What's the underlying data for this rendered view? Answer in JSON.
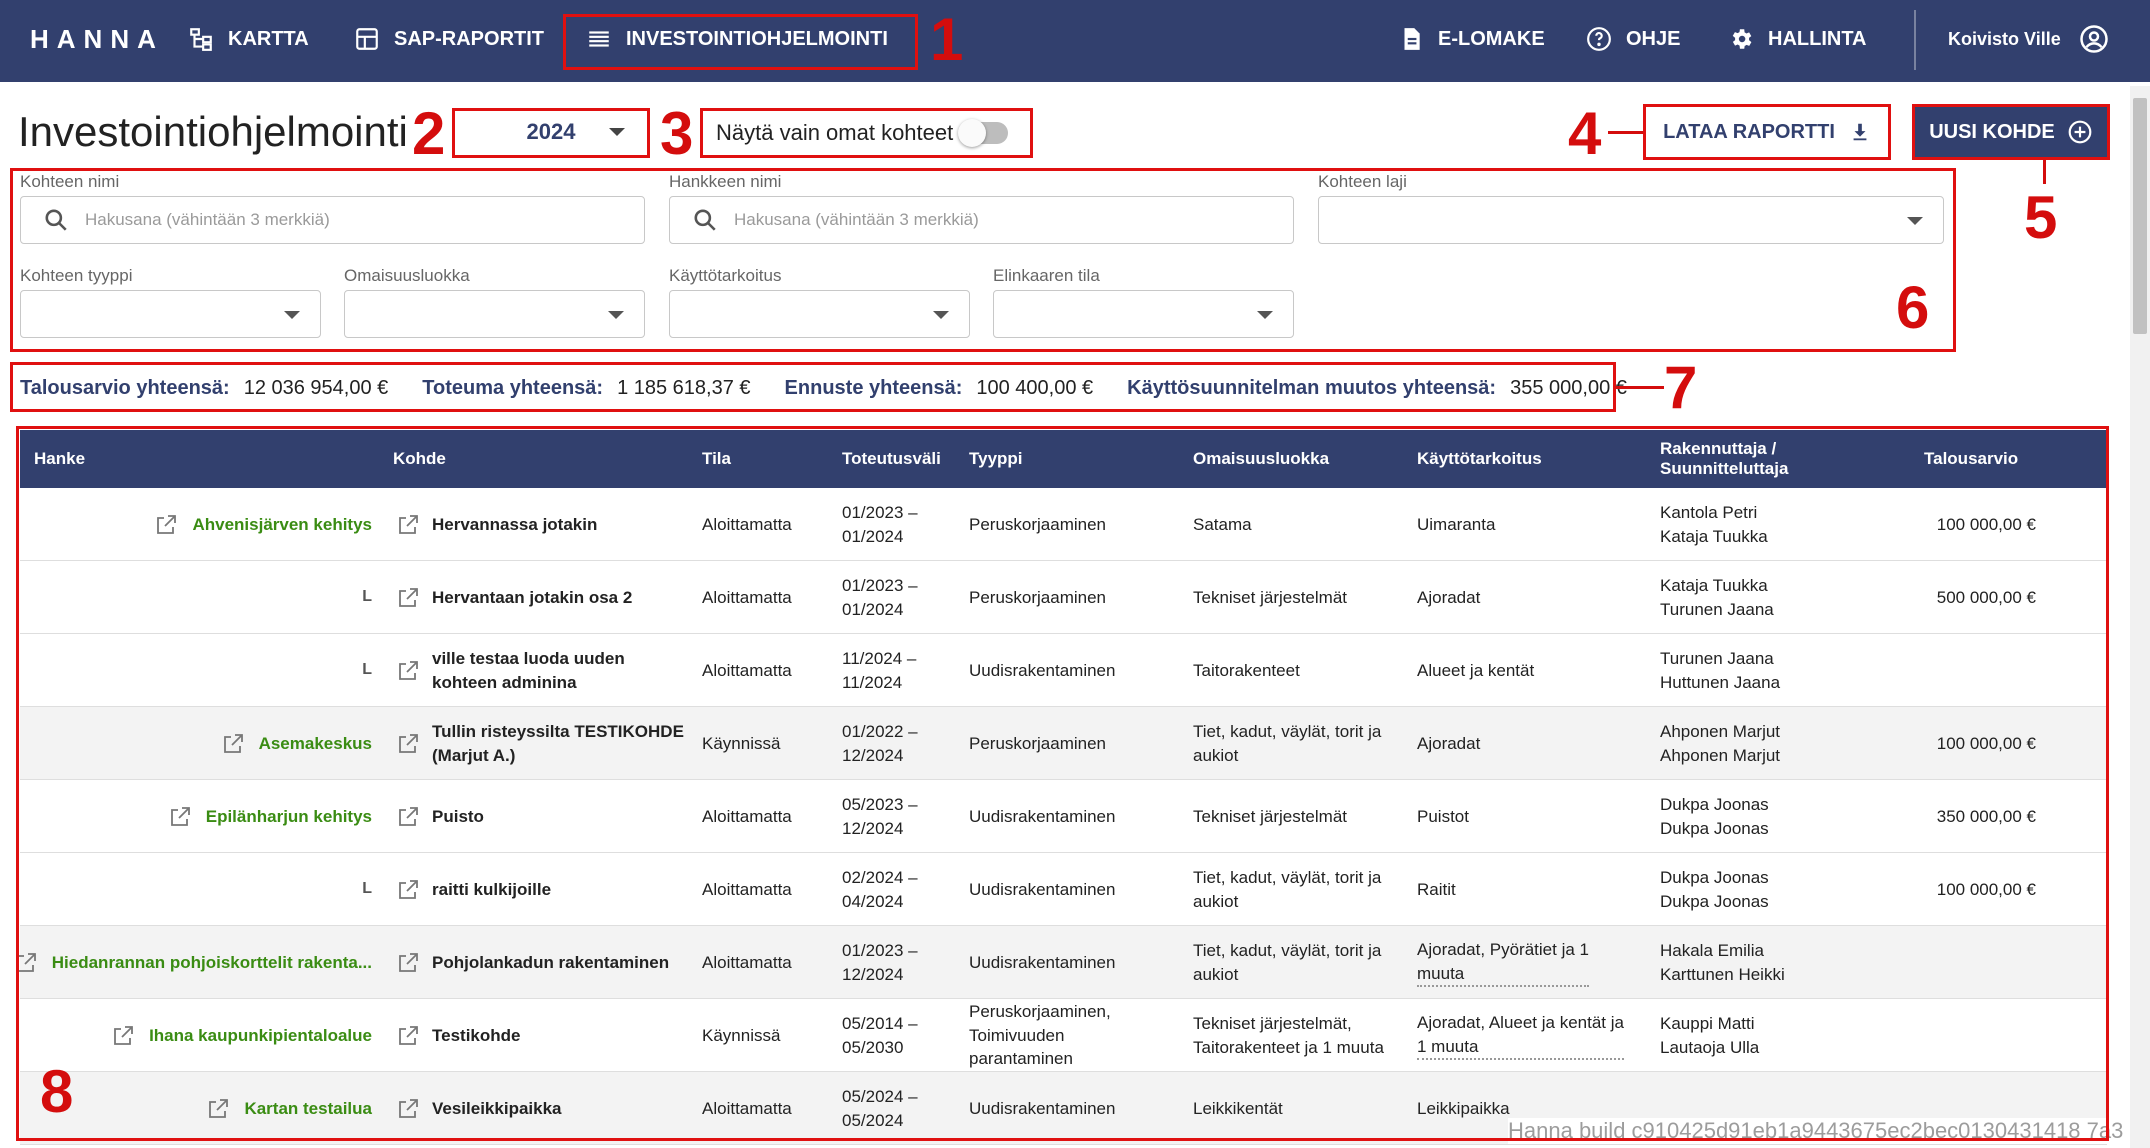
{
  "nav": {
    "logo": "HANNA",
    "items": [
      {
        "label": "KARTTA",
        "icon": "hierarchy-icon"
      },
      {
        "label": "SAP-RAPORTIT",
        "icon": "report-icon"
      },
      {
        "label": "INVESTOINTIOHJELMOINTI",
        "icon": "list-icon"
      }
    ],
    "right_items": [
      {
        "label": "E-LOMAKE",
        "icon": "document-icon"
      },
      {
        "label": "OHJE",
        "icon": "help-icon"
      },
      {
        "label": "HALLINTA",
        "icon": "gear-icon"
      }
    ],
    "user": "Koivisto Ville"
  },
  "page": {
    "title": "Investointiohjelmointi",
    "year": "2024",
    "toggle_label": "Näytä vain omat kohteet",
    "report_button": "LATAA RAPORTTI",
    "new_button": "UUSI KOHDE"
  },
  "filters": {
    "kohteen_nimi": {
      "label": "Kohteen nimi",
      "placeholder": "Hakusana (vähintään 3 merkkiä)"
    },
    "hankkeen_nimi": {
      "label": "Hankkeen nimi",
      "placeholder": "Hakusana (vähintään 3 merkkiä)"
    },
    "kohteen_laji": {
      "label": "Kohteen laji"
    },
    "kohteen_tyyppi": {
      "label": "Kohteen tyyppi"
    },
    "omaisuusluokka": {
      "label": "Omaisuusluokka"
    },
    "kayttotarkoitus": {
      "label": "Käyttötarkoitus"
    },
    "elinkaaren_tila": {
      "label": "Elinkaaren tila"
    }
  },
  "totals": {
    "talousarvio_label": "Talousarvio yhteensä:",
    "talousarvio_value": "12 036 954,00 €",
    "toteuma_label": "Toteuma yhteensä:",
    "toteuma_value": "1 185 618,37 €",
    "ennuste_label": "Ennuste yhteensä:",
    "ennuste_value": "100 400,00 €",
    "muutos_label": "Käyttösuunnitelman muutos yhteensä:",
    "muutos_value": "355 000,00 €"
  },
  "table": {
    "headers": {
      "hanke": "Hanke",
      "kohde": "Kohde",
      "tila": "Tila",
      "toteutusvali": "Toteutusväli",
      "tyyppi": "Tyyppi",
      "omaisuusluokka": "Omaisuusluokka",
      "kayttotarkoitus": "Käyttötarkoitus",
      "rakennuttaja_1": "Rakennuttaja /",
      "rakennuttaja_2": "Suunnitteluttaja",
      "talousarvio": "Talousarvio"
    },
    "rows": [
      {
        "hanke": "Ahvenisjärven kehitys",
        "child": "",
        "kohde": [
          "Hervannassa jotakin"
        ],
        "tila": "Aloittamatta",
        "vali": [
          "01/2023 –",
          "01/2024"
        ],
        "tyyppi": [
          "Peruskorjaaminen"
        ],
        "omaisuus": [
          "Satama"
        ],
        "kaytto": [
          "Uimaranta"
        ],
        "rak": [
          "Kantola Petri",
          "Kataja Tuukka"
        ],
        "talous": "100 000,00 €"
      },
      {
        "hanke": "",
        "child": "L",
        "kohde": [
          "Hervantaan jotakin osa 2"
        ],
        "tila": "Aloittamatta",
        "vali": [
          "01/2023 –",
          "01/2024"
        ],
        "tyyppi": [
          "Peruskorjaaminen"
        ],
        "omaisuus": [
          "Tekniset järjestelmät"
        ],
        "kaytto": [
          "Ajoradat"
        ],
        "rak": [
          "Kataja Tuukka",
          "Turunen Jaana"
        ],
        "talous": "500 000,00 €"
      },
      {
        "hanke": "",
        "child": "L",
        "kohde": [
          "ville testaa luoda uuden",
          "kohteen adminina"
        ],
        "tila": "Aloittamatta",
        "vali": [
          "11/2024 –",
          "11/2024"
        ],
        "tyyppi": [
          "Uudisrakentaminen"
        ],
        "omaisuus": [
          "Taitorakenteet"
        ],
        "kaytto": [
          "Alueet ja kentät"
        ],
        "rak": [
          "Turunen Jaana",
          "Huttunen Jaana"
        ],
        "talous": ""
      },
      {
        "hanke": "Asemakeskus",
        "child": "",
        "kohde": [
          "Tullin risteyssilta TESTIKOHDE",
          "(Marjut A.)"
        ],
        "tila": "Käynnissä",
        "vali": [
          "01/2022 –",
          "12/2024"
        ],
        "tyyppi": [
          "Peruskorjaaminen"
        ],
        "omaisuus": [
          "Tiet, kadut, väylät, torit ja",
          "aukiot"
        ],
        "kaytto": [
          "Ajoradat"
        ],
        "rak": [
          "Ahponen Marjut",
          "Ahponen Marjut"
        ],
        "talous": "100 000,00 €"
      },
      {
        "hanke": "Epilänharjun kehitys",
        "child": "",
        "kohde": [
          "Puisto"
        ],
        "tila": "Aloittamatta",
        "vali": [
          "05/2023 –",
          "12/2024"
        ],
        "tyyppi": [
          "Uudisrakentaminen"
        ],
        "omaisuus": [
          "Tekniset järjestelmät"
        ],
        "kaytto": [
          "Puistot"
        ],
        "rak": [
          "Dukpa Joonas",
          "Dukpa Joonas"
        ],
        "talous": "350 000,00 €"
      },
      {
        "hanke": "",
        "child": "L",
        "kohde": [
          "raitti kulkijoille"
        ],
        "tila": "Aloittamatta",
        "vali": [
          "02/2024 –",
          "04/2024"
        ],
        "tyyppi": [
          "Uudisrakentaminen"
        ],
        "omaisuus": [
          "Tiet, kadut, väylät, torit ja",
          "aukiot"
        ],
        "kaytto": [
          "Raitit"
        ],
        "rak": [
          "Dukpa Joonas",
          "Dukpa Joonas"
        ],
        "talous": "100 000,00 €"
      },
      {
        "hanke": "Hiedanrannan pohjoiskorttelit rakenta...",
        "child": "",
        "kohde": [
          "Pohjolankadun rakentaminen"
        ],
        "tila": "Aloittamatta",
        "vali": [
          "01/2023 –",
          "12/2024"
        ],
        "tyyppi": [
          "Uudisrakentaminen"
        ],
        "omaisuus": [
          "Tiet, kadut, väylät, torit ja",
          "aukiot"
        ],
        "kaytto": [
          "Ajoradat, Pyörätiet ja 1",
          "muuta"
        ],
        "rak": [
          "Hakala Emilia",
          "Karttunen Heikki"
        ],
        "talous": ""
      },
      {
        "hanke": "Ihana kaupunkipientaloalue",
        "child": "",
        "kohde": [
          "Testikohde"
        ],
        "tila": "Käynnissä",
        "vali": [
          "05/2014 –",
          "05/2030"
        ],
        "tyyppi": [
          "Peruskorjaaminen,",
          "Toimivuuden",
          "parantaminen"
        ],
        "omaisuus": [
          "Tekniset järjestelmät,",
          "Taitorakenteet ja 1 muuta"
        ],
        "kaytto": [
          "Ajoradat, Alueet ja kentät ja",
          "1 muuta"
        ],
        "rak": [
          "Kauppi Matti",
          "Lautaoja Ulla"
        ],
        "talous": ""
      },
      {
        "hanke": "Kartan testailua",
        "child": "",
        "kohde": [
          "Vesileikkipaikka"
        ],
        "tila": "Aloittamatta",
        "vali": [
          "05/2024 –",
          "05/2024"
        ],
        "tyyppi": [
          "Uudisrakentaminen"
        ],
        "omaisuus": [
          "Leikkikentät"
        ],
        "kaytto": [
          "Leikkipaikka"
        ],
        "rak": [],
        "talous": ""
      }
    ]
  },
  "annotations": [
    "1",
    "2",
    "3",
    "4",
    "5",
    "6",
    "7",
    "8"
  ],
  "build": "Hanna build c910425d91eb1a9443675ec2bec0130431418 7a3"
}
